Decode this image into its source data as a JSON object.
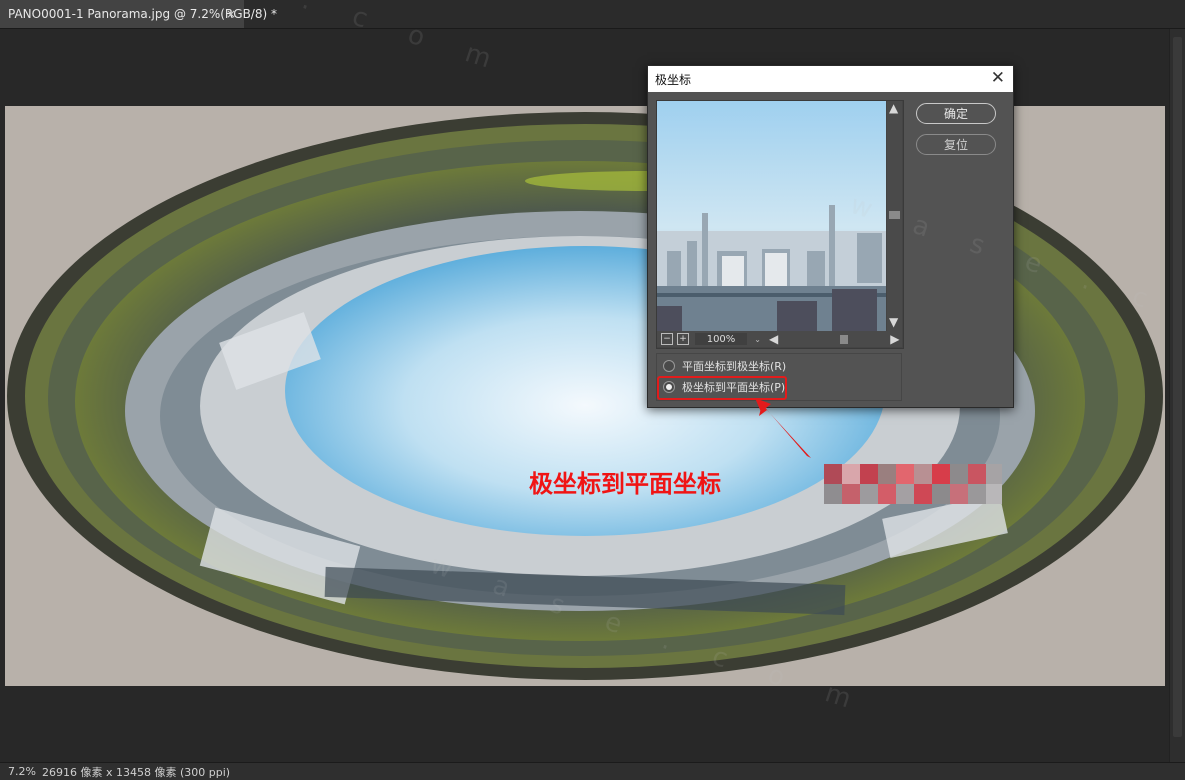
{
  "tab": {
    "title": "PANO0001-1 Panorama.jpg @ 7.2%(RGB/8) *",
    "close": "×"
  },
  "status": {
    "zoom": "7.2%",
    "doc_size": "26916 像素 x 13458 像素 (300 ppi)"
  },
  "dialog": {
    "title": "极坐标",
    "close": "✕",
    "ok_label": "确定",
    "reset_label": "复位",
    "preview_zoom": "100%",
    "options": [
      {
        "label": "平面坐标到极坐标(R)",
        "selected": false
      },
      {
        "label": "极坐标到平面坐标(P)",
        "selected": true
      }
    ]
  },
  "annotation": {
    "text": "极坐标到平面坐标",
    "color": "#f01414"
  },
  "watermark": "w a s e . c o m",
  "colors": {
    "background": "#282828",
    "dialog": "#535353",
    "highlight": "#e31b1b"
  }
}
